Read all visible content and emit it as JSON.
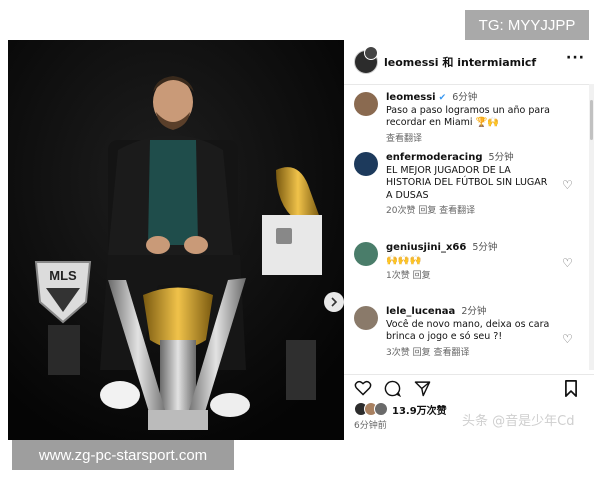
{
  "overlay": {
    "tg": "TG: MYYJJPP",
    "site": "www.zg-pc-starsport.com"
  },
  "photo": {
    "mls_text": "MLS"
  },
  "post": {
    "header": {
      "title": "leomessi 和 intermiamicf",
      "more": "···"
    },
    "caption": {
      "user": "leomessi",
      "time": "6分钟",
      "text": "Paso a paso logramos un año para recordar en Miami 🏆🙌",
      "translate": "查看翻译"
    },
    "comments": [
      {
        "user": "enfermoderacing",
        "time": "5分钟",
        "text": "EL MEJOR JUGADOR DE LA HISTORIA DEL FÚTBOL SIN LUGAR A DUSAS",
        "meta": "20次赞  回复  查看翻译",
        "avatar_color": "#1d3a5c"
      },
      {
        "user": "geniusjini_x66",
        "time": "5分钟",
        "text": "🙌🙌🙌",
        "meta": "1次赞  回复",
        "avatar_color": "#4a7d6a"
      },
      {
        "user": "lele_lucenaa",
        "time": "2分钟",
        "text": "Você de novo mano, deixa os cara brinca o jogo e só seu ?!",
        "meta": "3次赞  回复  查看翻译",
        "avatar_color": "#8a7a6a"
      }
    ],
    "likes": "13.9万次赞",
    "posted_ago": "6分钟前",
    "watermark": "头条 @音是少年Cd"
  }
}
